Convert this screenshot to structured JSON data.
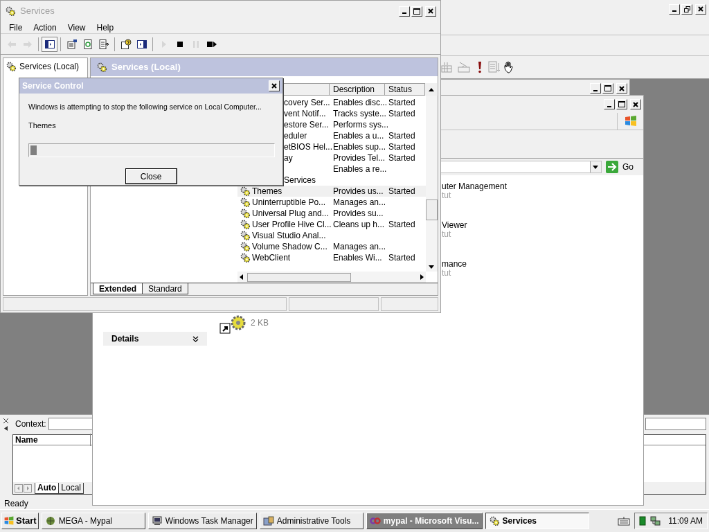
{
  "background_window": {
    "context_label": "Context:",
    "list_header": "Name",
    "tabs": [
      {
        "label": "Auto",
        "selected": true
      },
      {
        "label": "Local",
        "selected": false
      }
    ],
    "status": "Ready"
  },
  "admin_window": {
    "address_button": "Go",
    "file_size": "2 KB",
    "details_title": "Details",
    "items": [
      {
        "title": "uter Management",
        "subtitle": "tut"
      },
      {
        "title": "Viewer",
        "subtitle": "tut"
      },
      {
        "title": "mance",
        "subtitle": "tut"
      }
    ]
  },
  "services_window": {
    "title": "Services",
    "menu": [
      "File",
      "Action",
      "View",
      "Help"
    ],
    "toolbar": [
      {
        "kind": "back",
        "disabled": true
      },
      {
        "kind": "forward",
        "disabled": true
      },
      {
        "kind": "sep"
      },
      {
        "kind": "tree",
        "disabled": false
      },
      {
        "kind": "sep"
      },
      {
        "kind": "properties",
        "disabled": false
      },
      {
        "kind": "refresh",
        "disabled": false
      },
      {
        "kind": "export",
        "disabled": false
      },
      {
        "kind": "sep"
      },
      {
        "kind": "help",
        "disabled": false
      },
      {
        "kind": "pane",
        "disabled": false
      },
      {
        "kind": "sep"
      },
      {
        "kind": "play",
        "disabled": true
      },
      {
        "kind": "stop",
        "disabled": false
      },
      {
        "kind": "pause",
        "disabled": true
      },
      {
        "kind": "restart",
        "disabled": false
      }
    ],
    "tree_item": "Services (Local)",
    "pane_title": "Services (Local)",
    "columns": [
      "Description",
      "Status"
    ],
    "rows": [
      {
        "name": "covery Ser...",
        "description": "Enables disc...",
        "status": "Started",
        "partial": true,
        "selected": false
      },
      {
        "name": "vent Notif...",
        "description": "Tracks syste...",
        "status": "Started",
        "partial": true,
        "selected": false
      },
      {
        "name": "estore Ser...",
        "description": "Performs sys...",
        "partial": true,
        "selected": false
      },
      {
        "name": "eduler",
        "description": "Enables a u...",
        "status": "Started",
        "partial": true,
        "selected": false
      },
      {
        "name": "etBIOS Hel...",
        "description": "Enables sup...",
        "status": "Started",
        "partial": true,
        "selected": false
      },
      {
        "name": "ay",
        "description": "Provides Tel...",
        "status": "Started",
        "partial": true,
        "selected": false
      },
      {
        "description": "Enables a re...",
        "partial": true,
        "selected": false
      },
      {
        "name": "Services",
        "partial": true,
        "selected": false
      },
      {
        "name": "Themes",
        "description": "Provides us...",
        "status": "Started",
        "partial": false,
        "selected": true
      },
      {
        "name": "Uninterruptible Po...",
        "description": "Manages an...",
        "partial": false,
        "selected": false
      },
      {
        "name": "Universal Plug and...",
        "description": "Provides su...",
        "partial": false,
        "selected": false
      },
      {
        "name": "User Profile Hive Cl...",
        "description": "Cleans up h...",
        "status": "Started",
        "partial": false,
        "selected": false
      },
      {
        "name": "Visual Studio Anal...",
        "partial": false,
        "selected": false
      },
      {
        "name": "Volume Shadow C...",
        "description": "Manages an...",
        "partial": false,
        "selected": false
      },
      {
        "name": "WebClient",
        "description": "Enables Wi...",
        "status": "Started",
        "partial": false,
        "selected": false
      }
    ],
    "tabs": [
      {
        "label": "Extended",
        "selected": true
      },
      {
        "label": "Standard",
        "selected": false
      }
    ]
  },
  "dialog": {
    "title": "Service Control",
    "message": "Windows is attempting to stop the following service on Local Computer...",
    "service": "Themes",
    "level": 0.025,
    "button": "Close"
  },
  "taskbar": {
    "start": "Start",
    "tasks": [
      {
        "label": "MEGA - Mypal",
        "kind": "browser",
        "selected": false,
        "flashing": false
      },
      {
        "label": "Windows Task Manager",
        "kind": "monitor",
        "selected": false,
        "flashing": false
      },
      {
        "label": "Administrative Tools",
        "kind": "tools",
        "selected": false,
        "flashing": false
      },
      {
        "label": "mypal - Microsoft Visu...",
        "kind": "studio",
        "selected": false,
        "flashing": true
      },
      {
        "label": "Services",
        "kind": "gear",
        "selected": true,
        "flashing": false
      }
    ],
    "clock": "11:09 AM"
  }
}
